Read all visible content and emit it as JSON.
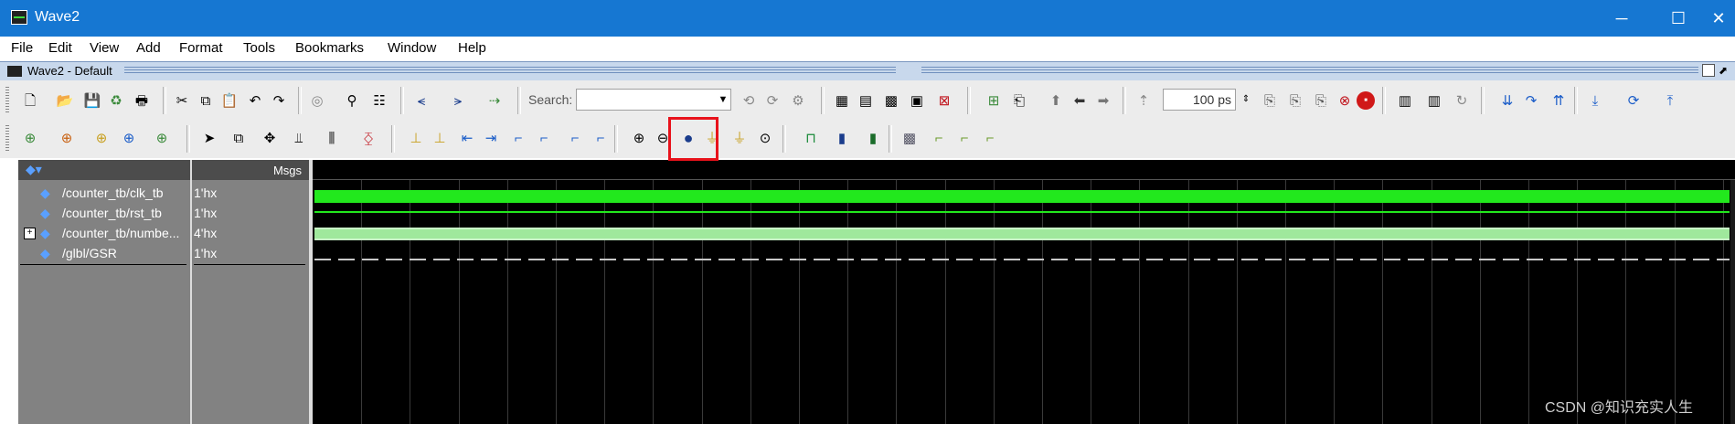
{
  "window": {
    "title": "Wave2",
    "controls": {
      "minimize": "─",
      "maximize": "☐",
      "close": "✕"
    }
  },
  "menu": [
    "File",
    "Edit",
    "View",
    "Add",
    "Format",
    "Tools",
    "Bookmarks",
    "Window",
    "Help"
  ],
  "subwindow": {
    "title": "Wave2 - Default"
  },
  "toolbar1": {
    "search_label": "Search:",
    "search_value": "",
    "time_value": "100",
    "time_unit": "ps"
  },
  "wave": {
    "msgs_header": "Msgs",
    "signals": [
      {
        "name": "/counter_tb/clk_tb",
        "value": "1'hx",
        "expandable": false
      },
      {
        "name": "/counter_tb/rst_tb",
        "value": "1'hx",
        "expandable": false
      },
      {
        "name": "/counter_tb/numbe...",
        "value": "4'hx",
        "expandable": true
      },
      {
        "name": "/glbl/GSR",
        "value": "1'hx",
        "expandable": false
      }
    ]
  },
  "watermark": "CSDN @知识充实人生",
  "colors": {
    "titlebar": "#1677d2",
    "wave_green": "#22e81d",
    "wave_bus": "#9fe89c",
    "highlight": "#e8121b"
  }
}
